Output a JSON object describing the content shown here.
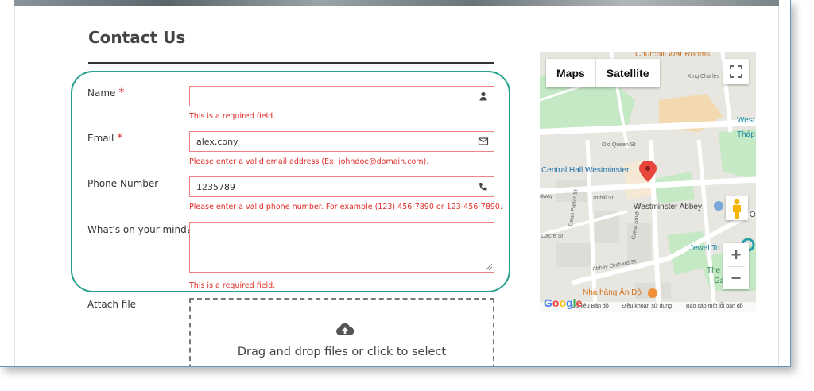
{
  "page": {
    "title": "Contact Us"
  },
  "form": {
    "name": {
      "label": "Name",
      "required_mark": "*",
      "value": "",
      "error": "This is a required field.",
      "icon": "user-icon"
    },
    "email": {
      "label": "Email",
      "required_mark": "*",
      "value": "alex.cony",
      "error": "Please enter a valid email address (Ex: johndoe@domain.com).",
      "icon": "envelope-icon"
    },
    "phone": {
      "label": "Phone Number",
      "value": "1235789",
      "error": "Please enter a valid phone number. For example (123) 456-7890 or 123-456-7890.",
      "icon": "phone-icon"
    },
    "message": {
      "label": "What's on your mind?",
      "required_mark": "*",
      "value": "",
      "error": "This is a required field."
    },
    "attach": {
      "label": "Attach file",
      "dropzone_text": "Drag and drop files or click to select",
      "icon": "cloud-upload-icon"
    }
  },
  "map": {
    "type_buttons": [
      "Maps",
      "Satellite"
    ],
    "labels": {
      "churchill": "Churchill War Rooms",
      "king_charles": "King Charles",
      "west": "West",
      "thap": "Tháp",
      "old_queen": "Old Queen St",
      "central_hall": "Central Hall Westminster",
      "tothill": "Tothill St",
      "way": "dway",
      "westminster_abbey": "Westminster Abbey",
      "ol": "Ol",
      "dean_farrar": "Dean Farrar St",
      "great_smith": "Great Smith St",
      "dacre": "Dacre St",
      "jewel": "Jewel To",
      "abbey_orchard": "Abbey Orchard St",
      "the_c": "The C",
      "ga": "Ga",
      "nha_hang": "Nhà hàng Ấn Độ"
    },
    "zoom_in": "+",
    "zoom_out": "−",
    "logo": "Google",
    "footer": {
      "data": "Dữ liệu Bản đồ",
      "terms": "Điều khoản sử dụng",
      "report": "Báo cáo một lỗi bản đồ"
    },
    "colors": {
      "park": "#c5e8c5",
      "road": "#ffffff",
      "building": "#f5e9d6",
      "pin": "#e8453c"
    }
  },
  "colors": {
    "accent_outline": "#26a08c",
    "error": "#e02b27",
    "field_border_error": "#ed8380"
  }
}
